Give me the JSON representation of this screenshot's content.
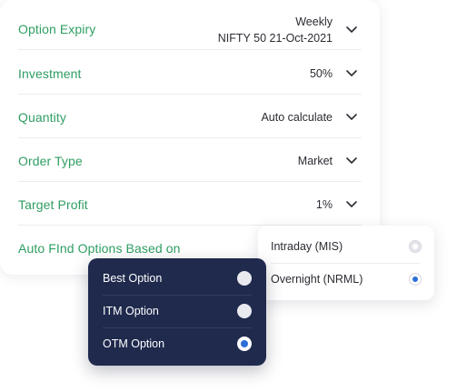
{
  "colors": {
    "label_green": "#2f9e63",
    "dark_panel": "#1f2a4d",
    "radio_selected": "#2b6fd6"
  },
  "settings": {
    "option_expiry": {
      "label": "Option Expiry",
      "value_line1": "Weekly",
      "value_line2": "NIFTY 50 21-Oct-2021"
    },
    "investment": {
      "label": "Investment",
      "value": "50%"
    },
    "quantity": {
      "label": "Quantity",
      "value": "Auto calculate"
    },
    "order_type": {
      "label": "Order Type",
      "value": "Market"
    },
    "target_profit": {
      "label": "Target Profit",
      "value": "1%"
    },
    "auto_find": {
      "label": "Auto FInd Options Based on"
    }
  },
  "option_dropdown": {
    "options": [
      {
        "label": "Best Option",
        "selected": false
      },
      {
        "label": "ITM Option",
        "selected": false
      },
      {
        "label": "OTM Option",
        "selected": true
      }
    ]
  },
  "product_dropdown": {
    "options": [
      {
        "label": "Intraday (MIS)",
        "selected": false
      },
      {
        "label": "Overnight (NRML)",
        "selected": true
      }
    ]
  }
}
